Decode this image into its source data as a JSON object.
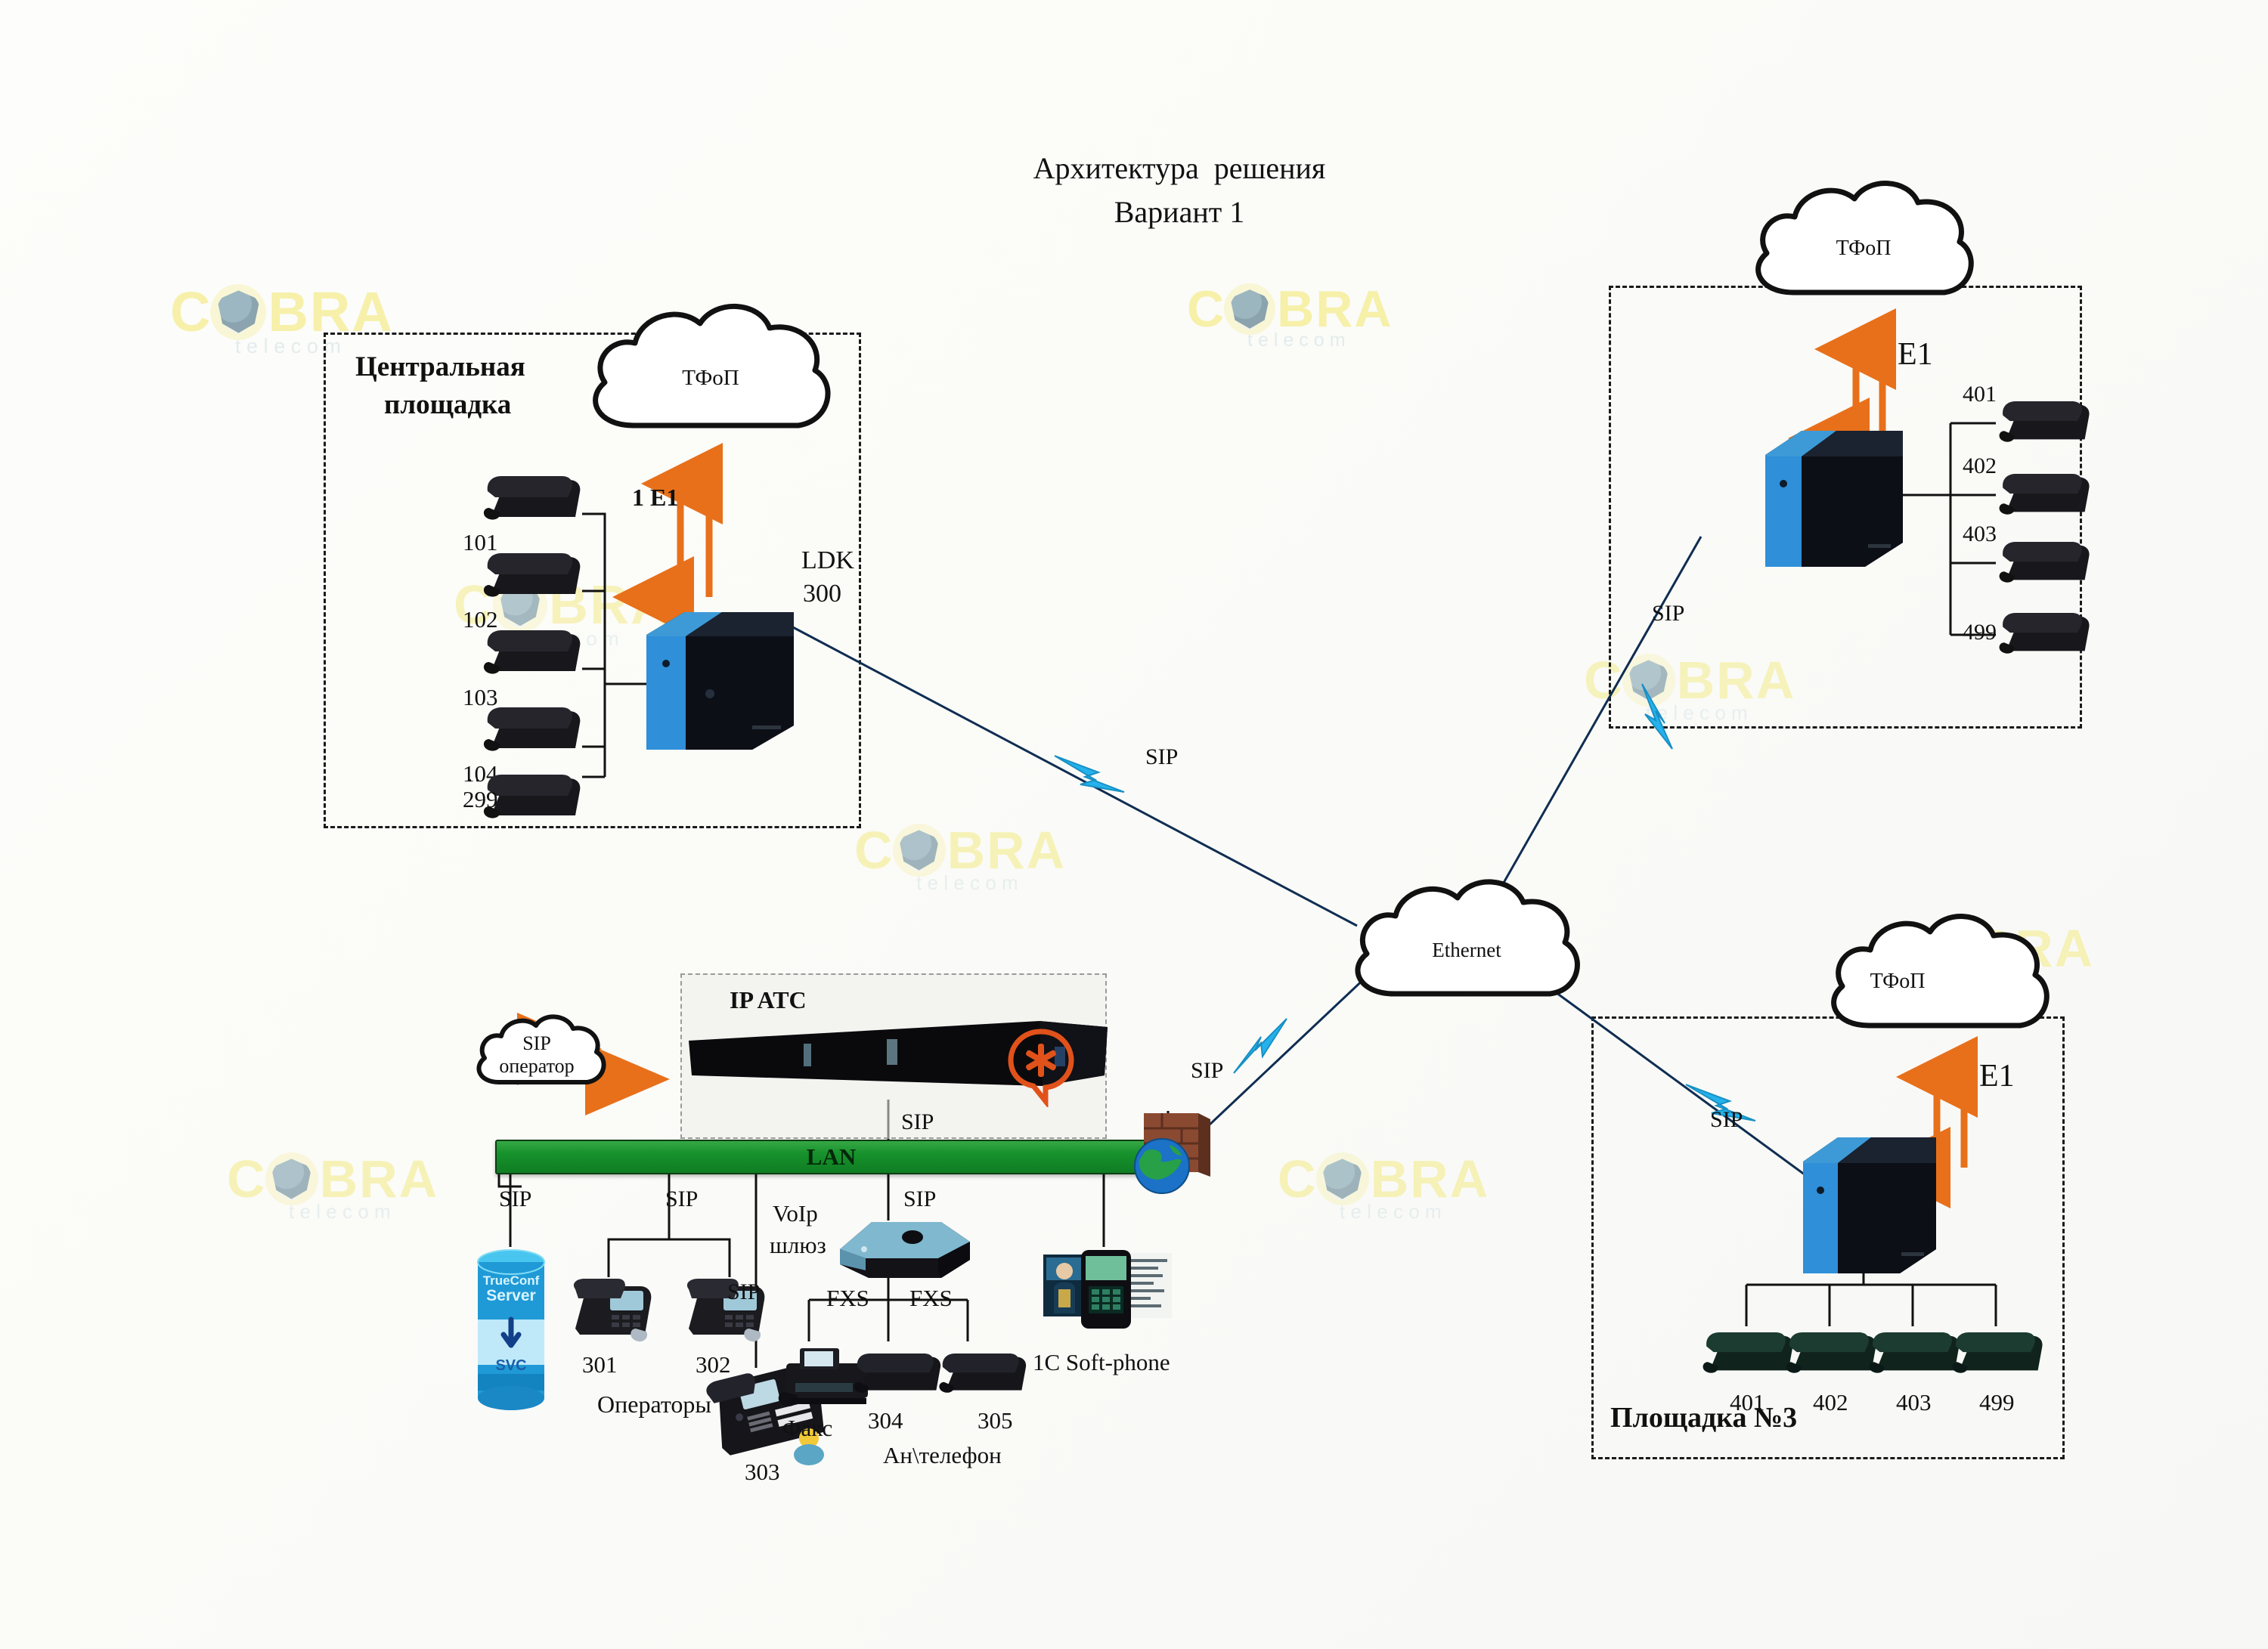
{
  "title": {
    "line1": "Архитектура  решения",
    "line2": "Вариант 1"
  },
  "watermark": {
    "c": "C",
    "bra": "BRA",
    "tagline": "telecom"
  },
  "central_site": {
    "label_line1": "Центральная",
    "label_line2": "площадка",
    "cloud": "ТФоП",
    "trunk_label": "1 E1",
    "pbx_line1": "LDK",
    "pbx_line2": "300",
    "extensions": [
      "101",
      "102",
      "103",
      "104",
      "..",
      "299"
    ]
  },
  "site2": {
    "cloud": "ТФоП",
    "trunk_label": "E1",
    "sip_label": "SIP",
    "extensions": [
      "401",
      "402",
      "403",
      "499"
    ]
  },
  "site3": {
    "name": "Площадка №3",
    "cloud": "ТФоП",
    "trunk_label": "E1",
    "sip_label": "SIP",
    "extensions": [
      "401",
      "402",
      "403",
      "499"
    ]
  },
  "core": {
    "cloud": "Ethernet"
  },
  "sip_links": {
    "central_to_core": "SIP",
    "site2_to_core": "SIP",
    "site3_to_core": "SIP",
    "lan_to_core": "SIP"
  },
  "hq": {
    "ipatc_label": "IP ATC",
    "sip_operator_line1": "SIP",
    "sip_operator_line2": "оператор",
    "lan_label": "LAN",
    "sip_ipatc_to_lan": "SIP",
    "sip_server": "SIP",
    "sip_operators": "SIP",
    "sip_phone303": "SIP",
    "sip_gateway": "SIP",
    "server": {
      "line1": "TrueConf",
      "line2": "Server",
      "line3": "SVC"
    },
    "operators": {
      "caption": "Операторы",
      "ext1": "301",
      "ext2": "302"
    },
    "desk_phone": {
      "ext": "303"
    },
    "gateway": {
      "line1": "VoIp",
      "line2": "шлюз",
      "port1": "FXS",
      "port2": "FXS"
    },
    "fax": {
      "caption": "Факс"
    },
    "analog": {
      "caption": "Ан\\телефон",
      "ext1": "304",
      "ext2": "305"
    },
    "softphone": {
      "caption": "1C Soft-phone"
    }
  },
  "colors": {
    "lan_green": "#17922c",
    "e1_orange": "#e8701a",
    "sip_blue": "#1f9ad6",
    "pbx_blue": "#2f8fd8",
    "accent_yellow": "#f2e86a"
  }
}
